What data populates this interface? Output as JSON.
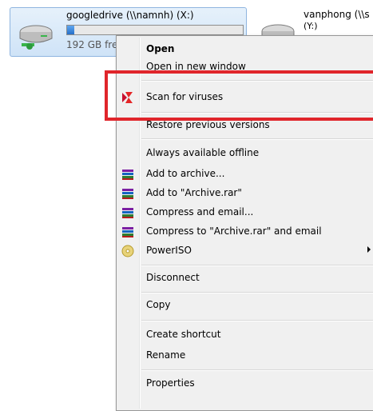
{
  "drives": [
    {
      "title": "googledrive (\\\\namnh) (X:)",
      "free": "192 GB fre",
      "usage_fraction": 0.04
    },
    {
      "title": "vanphong (\\\\s",
      "sub": "(Y:)"
    }
  ],
  "menu": {
    "items": [
      {
        "label": "Open",
        "bold": true
      },
      {
        "label": "Open in new window"
      },
      {
        "label": "Scan for viruses",
        "icon": "kaspersky-icon"
      },
      {
        "label": "Restore previous versions"
      },
      {
        "label": "Always available offline"
      },
      {
        "label": "Add to archive...",
        "icon": "winrar-icon"
      },
      {
        "label": "Add to \"Archive.rar\"",
        "icon": "winrar-icon"
      },
      {
        "label": "Compress and email...",
        "icon": "winrar-icon"
      },
      {
        "label": "Compress to \"Archive.rar\" and email",
        "icon": "winrar-icon"
      },
      {
        "label": "PowerISO",
        "icon": "poweriso-icon",
        "submenu": true
      },
      {
        "label": "Disconnect"
      },
      {
        "label": "Copy"
      },
      {
        "label": "Create shortcut"
      },
      {
        "label": "Rename"
      },
      {
        "label": "Properties"
      }
    ]
  },
  "colors": {
    "highlight": "#e0252b",
    "menu_bg": "#f0f0f0",
    "selection_border": "#8fb5e0"
  }
}
